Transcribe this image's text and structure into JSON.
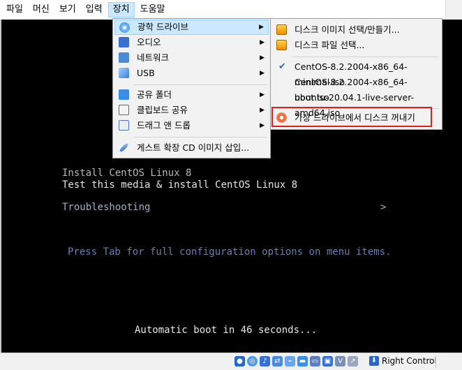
{
  "menubar": {
    "items": [
      "파일",
      "머신",
      "보기",
      "입력",
      "장치",
      "도움말"
    ],
    "active_index": 4
  },
  "devices_menu": {
    "items": [
      {
        "label": "광학 드라이브",
        "icon": "optical-disc-icon",
        "submenu": true
      },
      {
        "label": "오디오",
        "icon": "audio-icon",
        "submenu": true
      },
      {
        "label": "네트워크",
        "icon": "network-icon",
        "submenu": true
      },
      {
        "label": "USB",
        "icon": "usb-icon",
        "submenu": true
      },
      {
        "label": "공유 폴더",
        "icon": "shared-folder-icon",
        "submenu": true
      },
      {
        "label": "클립보드 공유",
        "icon": "clipboard-icon",
        "submenu": true
      },
      {
        "label": "드래그 앤 드롭",
        "icon": "drag-drop-icon",
        "submenu": true
      },
      {
        "label": "게스트 확장 CD 이미지 삽입...",
        "icon": "guest-additions-icon",
        "submenu": false
      }
    ]
  },
  "optical_submenu": {
    "items": [
      {
        "label": "디스크 이미지 선택/만들기...",
        "icon": "disk-image-icon"
      },
      {
        "label": "디스크 파일 선택...",
        "icon": "disk-file-icon"
      },
      {
        "label": "CentOS-8.2.2004-x86_64-minimal.iso",
        "checked": true
      },
      {
        "label": "CentOS-8.2.2004-x86_64-boot.iso",
        "checked": false
      },
      {
        "label": "ubuntu-20.04.1-live-server-amd64.iso",
        "checked": false
      },
      {
        "label": "가상 드라이브에서 디스크 꺼내기",
        "icon": "eject-disk-icon"
      }
    ]
  },
  "vm_screen": {
    "install": "Install CentOS Linux 8",
    "test_install": "Test this media & install CentOS Linux 8",
    "troubleshooting": "Troubleshooting",
    "troubleshooting_arrow": ">",
    "hint": "Press Tab for full configuration options on menu items.",
    "autoboot": "Automatic boot in 46 seconds..."
  },
  "statusbar": {
    "host_key": "Right Control"
  }
}
